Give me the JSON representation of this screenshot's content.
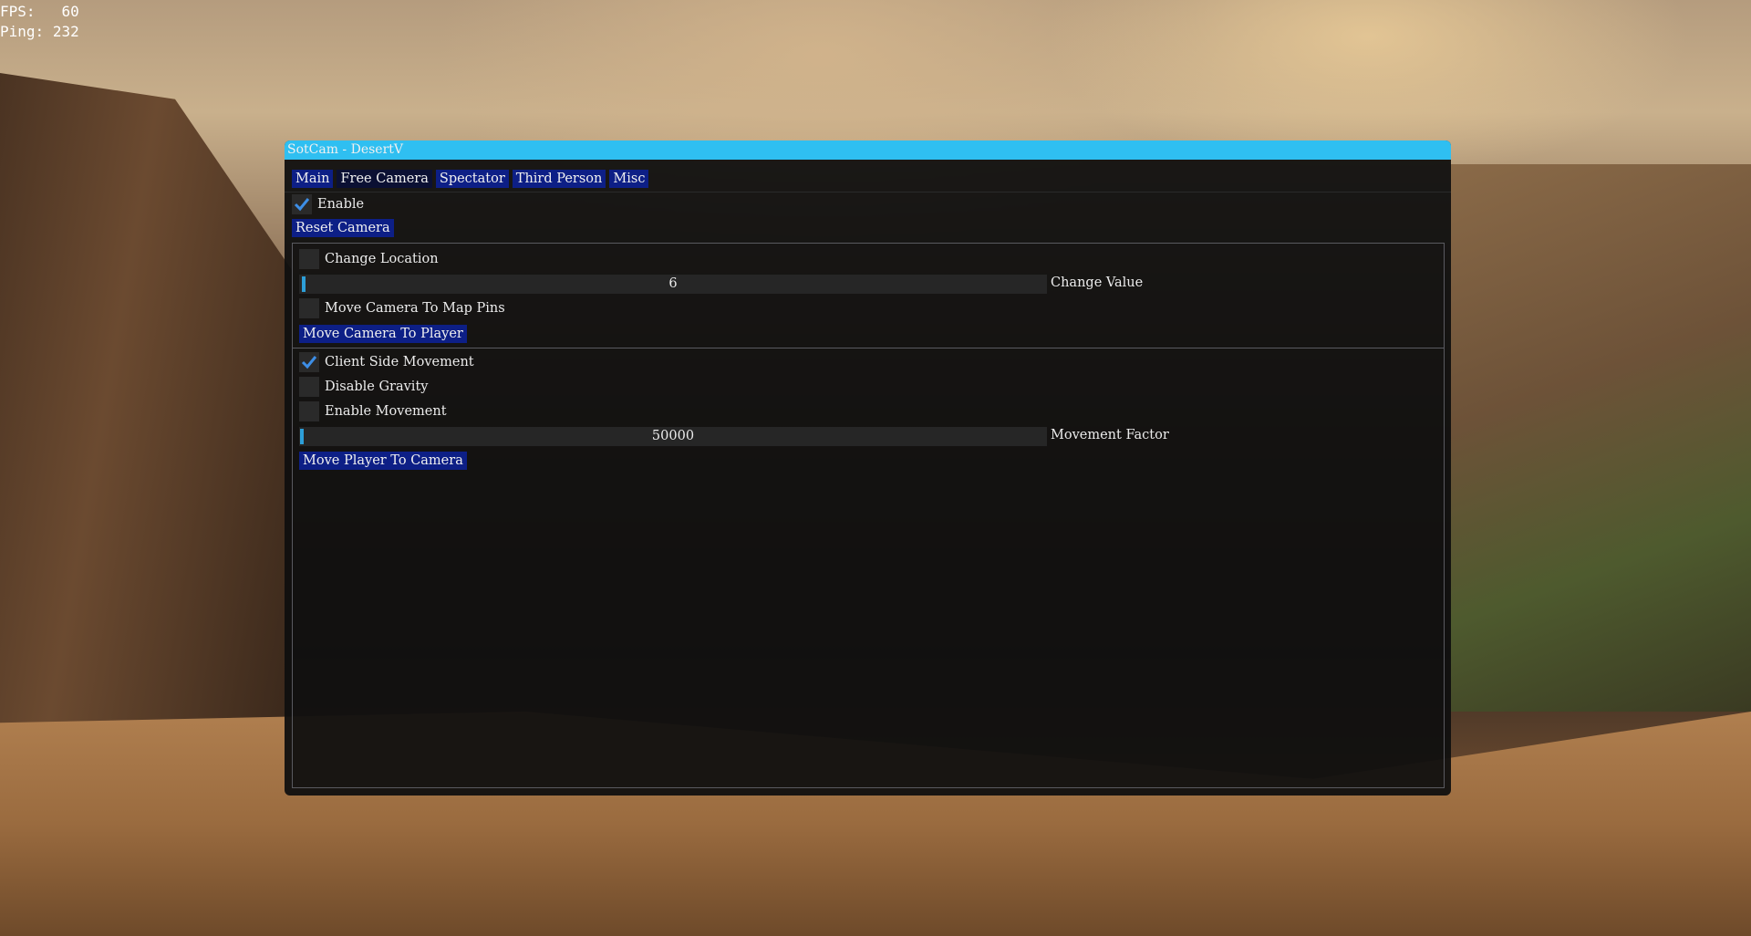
{
  "hud": {
    "fps_label": "FPS:",
    "fps_value": "60",
    "ping_label": "Ping:",
    "ping_value": "232"
  },
  "window": {
    "title": "SotCam - DesertV",
    "accent_color": "#2fbff1",
    "tabs": [
      {
        "label": "Main",
        "active": false
      },
      {
        "label": "Free Camera",
        "active": true
      },
      {
        "label": "Spectator",
        "active": false
      },
      {
        "label": "Third Person",
        "active": false
      },
      {
        "label": "Misc",
        "active": false
      }
    ],
    "enable": {
      "label": "Enable",
      "checked": true
    },
    "reset_camera": "Reset Camera",
    "location": {
      "change_location": {
        "label": "Change Location",
        "checked": false
      },
      "change_value": {
        "label": "Change Value",
        "value": "6"
      },
      "map_pins": {
        "label": "Move Camera To Map Pins",
        "checked": false
      },
      "move_camera_to_player": "Move Camera To Player"
    },
    "movement": {
      "client_side": {
        "label": "Client Side Movement",
        "checked": true
      },
      "disable_gravity": {
        "label": "Disable Gravity",
        "checked": false
      },
      "enable_movement": {
        "label": "Enable Movement",
        "checked": false
      },
      "movement_factor": {
        "label": "Movement Factor",
        "value": "50000"
      },
      "move_player_to_camera": "Move Player To Camera"
    }
  }
}
